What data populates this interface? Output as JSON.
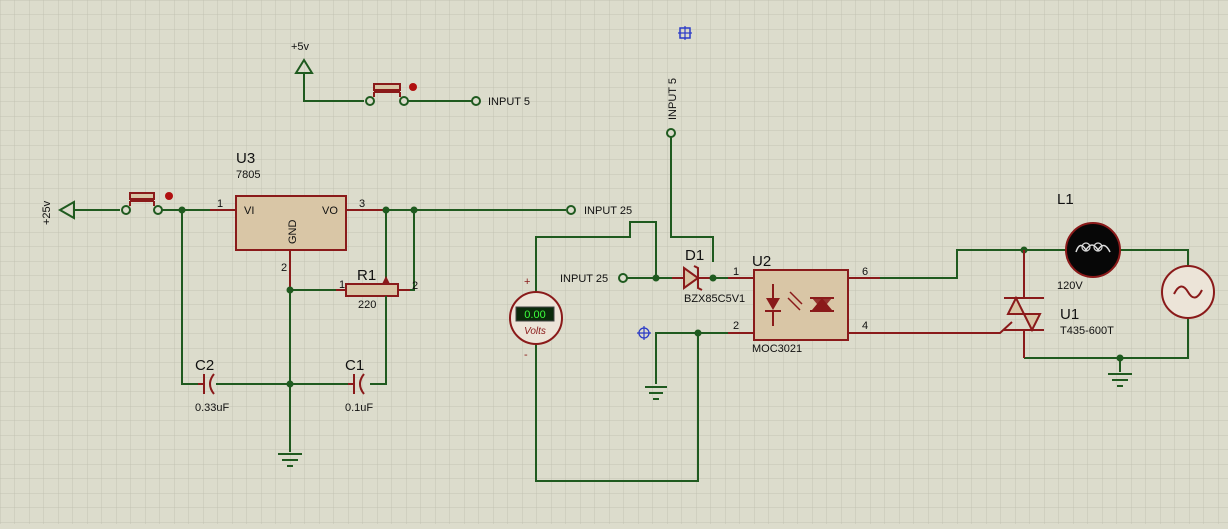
{
  "power": {
    "v25": "+25v",
    "v5": "+5v"
  },
  "terminals": {
    "input5": "INPUT 5",
    "input25": "INPUT 25"
  },
  "u3": {
    "ref": "U3",
    "part": "7805",
    "vi": "VI",
    "vo": "VO",
    "gnd": "GND",
    "pin1": "1",
    "pin2": "2",
    "pin3": "3"
  },
  "r1": {
    "ref": "R1",
    "value": "220",
    "pin1": "1",
    "pin2": "2"
  },
  "c1": {
    "ref": "C1",
    "value": "0.1uF"
  },
  "c2": {
    "ref": "C2",
    "value": "0.33uF"
  },
  "d1": {
    "ref": "D1",
    "part": "BZX85C5V1"
  },
  "u2": {
    "ref": "U2",
    "part": "MOC3021",
    "pin1": "1",
    "pin2": "2",
    "pin4": "4",
    "pin6": "6"
  },
  "meter": {
    "reading": "0.00",
    "unit": "Volts",
    "plus": "+",
    "minus": "-"
  },
  "l1": {
    "ref": "L1",
    "value": "120V"
  },
  "u1": {
    "ref": "U1",
    "part": "T435-600T"
  }
}
